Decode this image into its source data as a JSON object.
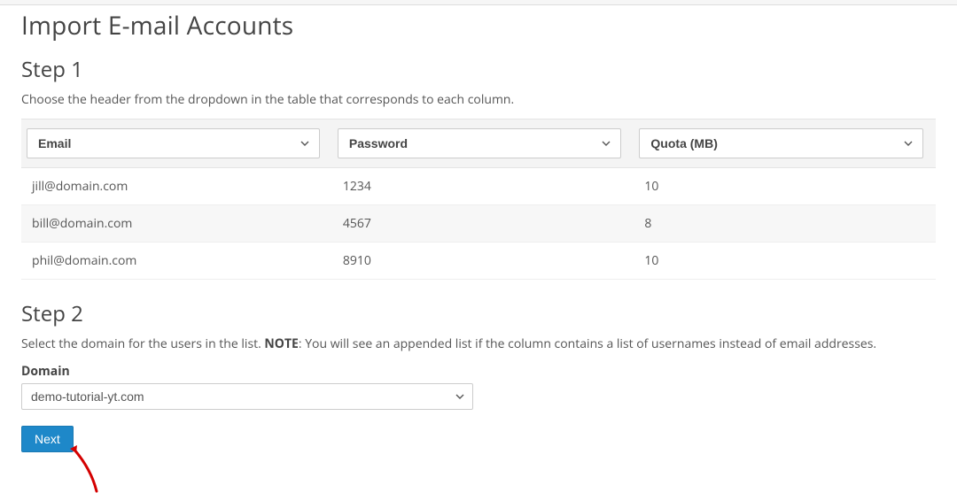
{
  "page": {
    "title": "Import E-mail Accounts"
  },
  "step1": {
    "heading": "Step 1",
    "description": "Choose the header from the dropdown in the table that corresponds to each column.",
    "columns": [
      {
        "label": "Email"
      },
      {
        "label": "Password"
      },
      {
        "label": "Quota (MB)"
      }
    ],
    "rows": [
      {
        "c0": "jill@domain.com",
        "c1": "1234",
        "c2": "10"
      },
      {
        "c0": "bill@domain.com",
        "c1": "4567",
        "c2": "8"
      },
      {
        "c0": "phil@domain.com",
        "c1": "8910",
        "c2": "10"
      }
    ]
  },
  "step2": {
    "heading": "Step 2",
    "description_pre": "Select the domain for the users in the list. ",
    "description_note": "NOTE",
    "description_post": ": You will see an appended list if the column contains a list of usernames instead of email addresses.",
    "domain_label": "Domain",
    "domain_value": "demo-tutorial-yt.com"
  },
  "buttons": {
    "next": "Next"
  }
}
